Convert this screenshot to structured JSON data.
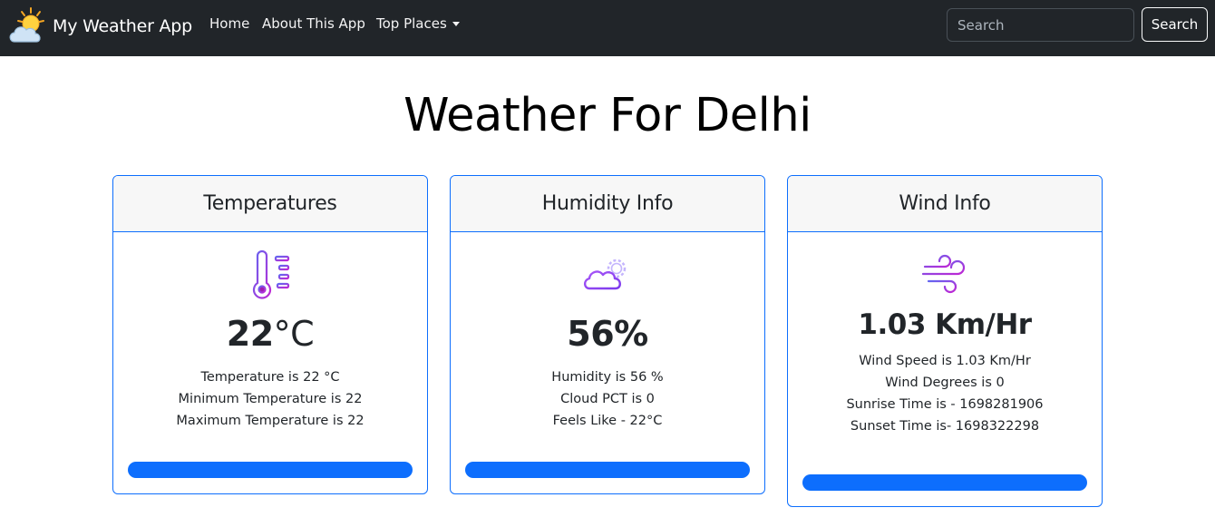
{
  "navbar": {
    "brand": "My Weather App",
    "links": [
      "Home",
      "About This App",
      "Top Places"
    ],
    "search_placeholder": "Search",
    "search_button": "Search"
  },
  "page": {
    "title": "Weather For Delhi"
  },
  "cards": {
    "temperature": {
      "title": "Temperatures",
      "value": "22",
      "unit": "°C",
      "lines": [
        "Temperature is 22 °C",
        "Minimum Temperature is 22",
        "Maximum Temperature is 22"
      ]
    },
    "humidity": {
      "title": "Humidity Info",
      "value": "56%",
      "lines": [
        "Humidity is 56 %",
        "Cloud PCT is 0",
        "Feels Like - 22°C"
      ]
    },
    "wind": {
      "title": "Wind Info",
      "value": "1.03 Km/Hr",
      "lines": [
        "Wind Speed is 1.03 Km/Hr",
        "Wind Degrees is 0",
        "Sunrise Time is - 1698281906",
        "Sunset Time is- 1698322298"
      ]
    }
  },
  "colors": {
    "navbar_bg": "#212529",
    "accent": "#0d6efd",
    "icon_gradient": [
      "#a855f7",
      "#7c3aed"
    ]
  },
  "icons": {
    "brand": "sun-cloud-icon",
    "temperature": "thermometer-icon",
    "humidity": "cloud-gear-icon",
    "wind": "wind-icon"
  }
}
